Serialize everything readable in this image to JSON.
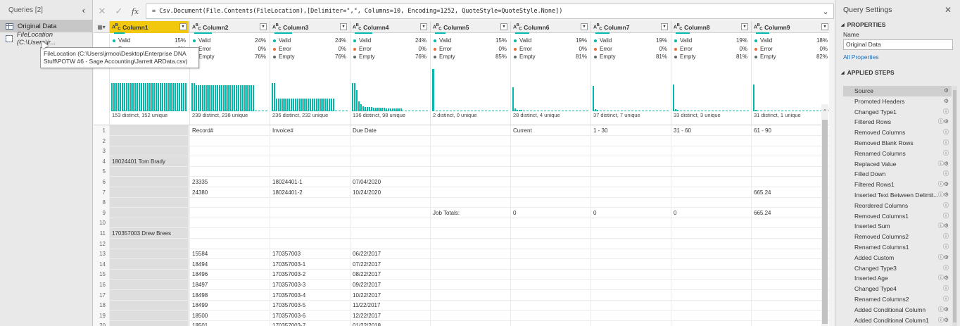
{
  "queries": {
    "title": "Queries [2]",
    "collapse_icon": "‹",
    "items": [
      {
        "label": "Original Data",
        "selected": true,
        "icon": "table-icon"
      },
      {
        "label": "FileLocation (C:\\Users\\jr...",
        "selected": false,
        "icon": "parameter-icon"
      }
    ],
    "tooltip": "FileLocation (C:\\Users\\jrmoo\\Desktop\\Enterprise DNA Stuff\\POTW #6 - Sage Accounting\\Jarrett ARData.csv)"
  },
  "formula_bar": {
    "cancel": "✕",
    "commit": "✓",
    "fx": "fx",
    "formula": "= Csv.Document(File.Contents(FileLocation),[Delimiter=\",\", Columns=10, Encoding=1252, QuoteStyle=QuoteStyle.None])",
    "expand": "⌄"
  },
  "grid": {
    "columns": [
      {
        "name": "Column1",
        "valid": "15%",
        "error": "0%",
        "empty": "85%",
        "distinct": "153 distinct, 152 unique",
        "selected": true
      },
      {
        "name": "Column2",
        "valid": "24%",
        "error": "0%",
        "empty": "76%",
        "distinct": "239 distinct, 238 unique"
      },
      {
        "name": "Column3",
        "valid": "24%",
        "error": "0%",
        "empty": "76%",
        "distinct": "236 distinct, 232 unique"
      },
      {
        "name": "Column4",
        "valid": "24%",
        "error": "0%",
        "empty": "76%",
        "distinct": "136 distinct, 98 unique"
      },
      {
        "name": "Column5",
        "valid": "15%",
        "error": "0%",
        "empty": "85%",
        "distinct": "2 distinct, 0 unique"
      },
      {
        "name": "Column6",
        "valid": "19%",
        "error": "0%",
        "empty": "81%",
        "distinct": "28 distinct, 4 unique"
      },
      {
        "name": "Column7",
        "valid": "19%",
        "error": "0%",
        "empty": "81%",
        "distinct": "37 distinct, 7 unique"
      },
      {
        "name": "Column8",
        "valid": "19%",
        "error": "0%",
        "empty": "81%",
        "distinct": "33 distinct, 3 unique"
      },
      {
        "name": "Column9",
        "valid": "18%",
        "error": "0%",
        "empty": "82%",
        "distinct": "31 distinct, 1 unique"
      }
    ],
    "labels": {
      "valid": "Valid",
      "error": "Error",
      "empty": "Empty"
    },
    "rows": [
      {
        "n": "1",
        "c": [
          "",
          "Record#",
          "Invoice#",
          "Due Date",
          "",
          "Current",
          "1 - 30",
          "31 - 60",
          "61 - 90"
        ]
      },
      {
        "n": "2",
        "c": [
          "",
          "",
          "",
          "",
          "",
          "",
          "",
          "",
          ""
        ]
      },
      {
        "n": "3",
        "c": [
          "",
          "",
          "",
          "",
          "",
          "",
          "",
          "",
          ""
        ]
      },
      {
        "n": "4",
        "c": [
          "18024401  Tom Brady",
          "",
          "",
          "",
          "",
          "",
          "",
          "",
          ""
        ]
      },
      {
        "n": "5",
        "c": [
          "",
          "",
          "",
          "",
          "",
          "",
          "",
          "",
          ""
        ]
      },
      {
        "n": "6",
        "c": [
          "",
          "23335",
          "18024401-1",
          "07/04/2020",
          "",
          "",
          "",
          "",
          ""
        ]
      },
      {
        "n": "7",
        "c": [
          "",
          "24380",
          "18024401-2",
          "10/24/2020",
          "",
          "",
          "",
          "",
          "665.24"
        ]
      },
      {
        "n": "8",
        "c": [
          "",
          "",
          "",
          "",
          "",
          "",
          "",
          "",
          ""
        ]
      },
      {
        "n": "9",
        "c": [
          "",
          "",
          "",
          "",
          "Job Totals:",
          "0",
          "0",
          "0",
          "665.24"
        ]
      },
      {
        "n": "10",
        "c": [
          "",
          "",
          "",
          "",
          "",
          "",
          "",
          "",
          ""
        ]
      },
      {
        "n": "11",
        "c": [
          "170357003  Drew Brees",
          "",
          "",
          "",
          "",
          "",
          "",
          "",
          ""
        ]
      },
      {
        "n": "12",
        "c": [
          "",
          "",
          "",
          "",
          "",
          "",
          "",
          "",
          ""
        ]
      },
      {
        "n": "13",
        "c": [
          "",
          "15584",
          "170357003",
          "06/22/2017",
          "",
          "",
          "",
          "",
          ""
        ]
      },
      {
        "n": "14",
        "c": [
          "",
          "18494",
          "170357003-1",
          "07/22/2017",
          "",
          "",
          "",
          "",
          ""
        ]
      },
      {
        "n": "15",
        "c": [
          "",
          "18496",
          "170357003-2",
          "08/22/2017",
          "",
          "",
          "",
          "",
          ""
        ]
      },
      {
        "n": "16",
        "c": [
          "",
          "18497",
          "170357003-3",
          "09/22/2017",
          "",
          "",
          "",
          "",
          ""
        ]
      },
      {
        "n": "17",
        "c": [
          "",
          "18498",
          "170357003-4",
          "10/22/2017",
          "",
          "",
          "",
          "",
          ""
        ]
      },
      {
        "n": "18",
        "c": [
          "",
          "18499",
          "170357003-5",
          "11/22/2017",
          "",
          "",
          "",
          "",
          ""
        ]
      },
      {
        "n": "19",
        "c": [
          "",
          "18500",
          "170357003-6",
          "12/22/2017",
          "",
          "",
          "",
          "",
          ""
        ]
      },
      {
        "n": "20",
        "c": [
          "",
          "18501",
          "170357003-7",
          "01/22/2018",
          "",
          "",
          "",
          "",
          ""
        ]
      }
    ]
  },
  "settings": {
    "title": "Query Settings",
    "close": "✕",
    "properties_header": "PROPERTIES",
    "name_label": "Name",
    "name_value": "Original Data",
    "all_properties": "All Properties",
    "applied_steps_header": "APPLIED STEPS",
    "steps": [
      {
        "label": "Source",
        "icon": "⚙",
        "selected": true
      },
      {
        "label": "Promoted Headers",
        "icon": "⚙"
      },
      {
        "label": "Changed Type1",
        "icon": "ⓘ"
      },
      {
        "label": "Filtered Rows",
        "icon": "ⓘ⚙"
      },
      {
        "label": "Removed Columns",
        "icon": "ⓘ"
      },
      {
        "label": "Removed Blank Rows",
        "icon": "ⓘ"
      },
      {
        "label": "Renamed Columns",
        "icon": "ⓘ"
      },
      {
        "label": "Replaced Value",
        "icon": "ⓘ⚙"
      },
      {
        "label": "Filled Down",
        "icon": "ⓘ"
      },
      {
        "label": "Filtered Rows1",
        "icon": "ⓘ⚙"
      },
      {
        "label": "Inserted Text Between Delimit...",
        "icon": "ⓘ⚙"
      },
      {
        "label": "Reordered Columns",
        "icon": "ⓘ"
      },
      {
        "label": "Removed Columns1",
        "icon": "ⓘ"
      },
      {
        "label": "Inserted Sum",
        "icon": "ⓘ⚙"
      },
      {
        "label": "Removed Columns2",
        "icon": "ⓘ"
      },
      {
        "label": "Renamed Columns1",
        "icon": "ⓘ"
      },
      {
        "label": "Added Custom",
        "icon": "ⓘ⚙"
      },
      {
        "label": "Changed Type3",
        "icon": "ⓘ"
      },
      {
        "label": "Inserted Age",
        "icon": "ⓘ⚙"
      },
      {
        "label": "Changed Type4",
        "icon": "ⓘ"
      },
      {
        "label": "Renamed Columns2",
        "icon": "ⓘ"
      },
      {
        "label": "Added Conditional Column",
        "icon": "ⓘ⚙"
      },
      {
        "label": "Added Conditional Column1",
        "icon": "ⓘ⚙"
      }
    ]
  },
  "colors": {
    "accent": "#01b8aa",
    "selected_header": "#f2c80f",
    "valid_dot": "#01b8aa",
    "error_dot": "#e66c37",
    "empty_dot": "#5f6b6d"
  }
}
